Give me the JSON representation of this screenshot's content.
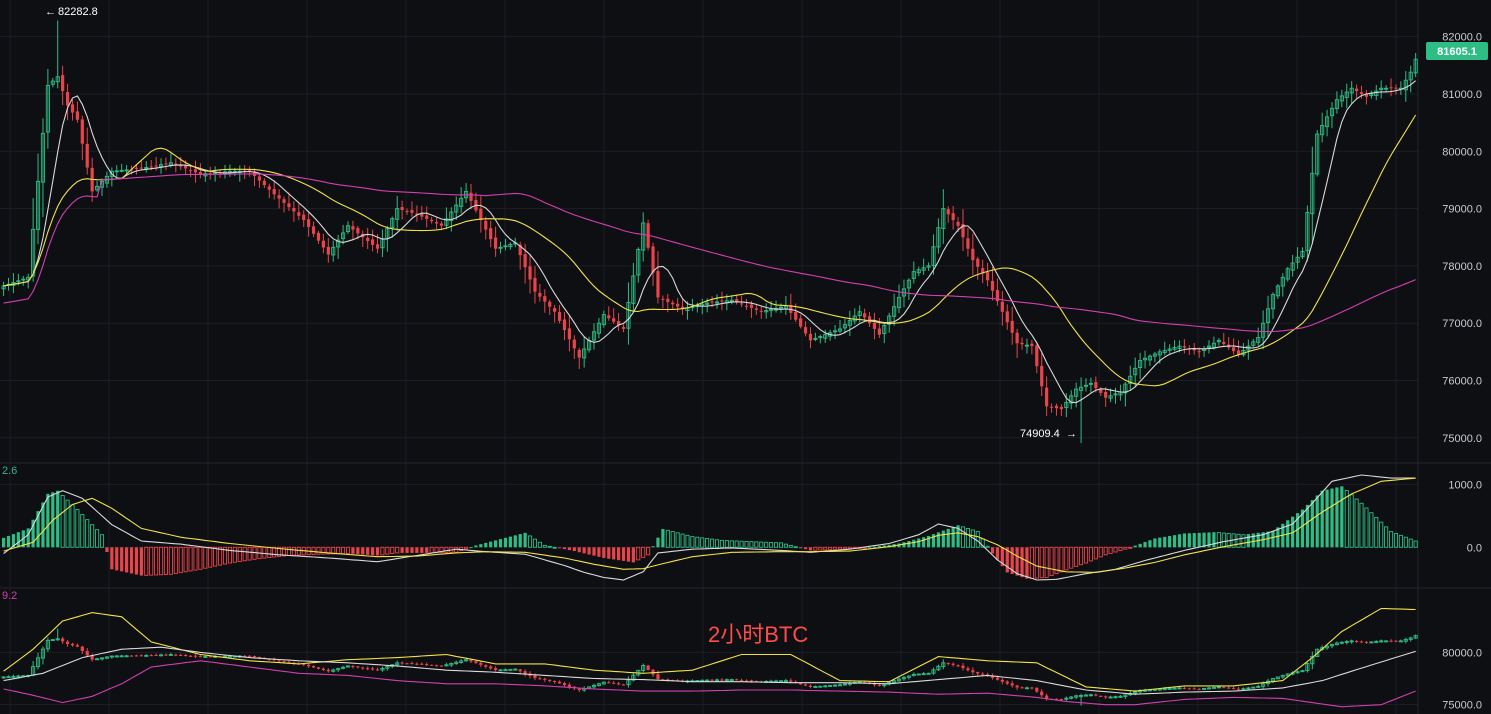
{
  "watermark": "2小时BTC",
  "colors": {
    "background": "#0e0f12",
    "up": "#2ebd85",
    "down": "#e9444a",
    "ma_fast": "#d9d9d9",
    "ma_mid": "#f0e24a",
    "ma_slow": "#d13fb1",
    "grid": "#1c1e24"
  },
  "chart_data": [
    {
      "type": "candlestick",
      "y_ticks": [
        "82000.0",
        "81000.0",
        "80000.0",
        "79000.0",
        "78000.0",
        "77000.0",
        "76000.0",
        "75000.0"
      ],
      "ylim": [
        74700,
        82500
      ],
      "high_label": "82282.8",
      "low_label": "74909.4",
      "last_price": "81605.1",
      "close_path": [
        [
          0,
          77650
        ],
        [
          5,
          77800
        ],
        [
          9,
          81150
        ],
        [
          11,
          81300
        ],
        [
          13,
          80800
        ],
        [
          15,
          80550
        ],
        [
          18,
          79300
        ],
        [
          22,
          79650
        ],
        [
          28,
          79700
        ],
        [
          34,
          79800
        ],
        [
          40,
          79600
        ],
        [
          46,
          79650
        ],
        [
          50,
          79650
        ],
        [
          55,
          79250
        ],
        [
          61,
          78800
        ],
        [
          66,
          78200
        ],
        [
          70,
          78700
        ],
        [
          76,
          78300
        ],
        [
          80,
          79000
        ],
        [
          84,
          78900
        ],
        [
          89,
          78700
        ],
        [
          94,
          79300
        ],
        [
          100,
          78300
        ],
        [
          104,
          78400
        ],
        [
          108,
          77550
        ],
        [
          112,
          77200
        ],
        [
          117,
          76400
        ],
        [
          122,
          77150
        ],
        [
          126,
          76900
        ],
        [
          130,
          78750
        ],
        [
          133,
          77450
        ],
        [
          138,
          77250
        ],
        [
          143,
          77350
        ],
        [
          148,
          77400
        ],
        [
          154,
          77200
        ],
        [
          159,
          77300
        ],
        [
          164,
          76700
        ],
        [
          170,
          76900
        ],
        [
          174,
          77200
        ],
        [
          178,
          76800
        ],
        [
          182,
          77450
        ],
        [
          185,
          77900
        ],
        [
          188,
          78000
        ],
        [
          191,
          79000
        ],
        [
          194,
          78700
        ],
        [
          197,
          78100
        ],
        [
          200,
          77750
        ],
        [
          203,
          77200
        ],
        [
          206,
          76650
        ],
        [
          209,
          76600
        ],
        [
          212,
          75550
        ],
        [
          215,
          75500
        ],
        [
          218,
          75850
        ],
        [
          221,
          75950
        ],
        [
          224,
          75700
        ],
        [
          227,
          75800
        ],
        [
          231,
          76350
        ],
        [
          235,
          76500
        ],
        [
          239,
          76600
        ],
        [
          243,
          76500
        ],
        [
          247,
          76700
        ],
        [
          251,
          76450
        ],
        [
          255,
          76750
        ],
        [
          258,
          77500
        ],
        [
          261,
          77950
        ],
        [
          264,
          78250
        ],
        [
          267,
          80300
        ],
        [
          271,
          80900
        ],
        [
          274,
          81100
        ],
        [
          277,
          80950
        ],
        [
          280,
          81100
        ],
        [
          284,
          81100
        ],
        [
          286,
          81380
        ],
        [
          287,
          81605.1
        ]
      ]
    },
    {
      "type": "bar",
      "panel": "macd",
      "y_ticks": [
        "1000.0",
        "0.0"
      ],
      "ylim": [
        -600,
        1150
      ],
      "corner_label": "2.6",
      "histogram_path": [
        [
          0,
          150
        ],
        [
          5,
          300
        ],
        [
          9,
          850
        ],
        [
          11,
          900
        ],
        [
          15,
          600
        ],
        [
          20,
          200
        ],
        [
          22,
          -350
        ],
        [
          28,
          -450
        ],
        [
          34,
          -430
        ],
        [
          40,
          -350
        ],
        [
          46,
          -250
        ],
        [
          52,
          -180
        ],
        [
          58,
          -130
        ],
        [
          64,
          -110
        ],
        [
          70,
          -100
        ],
        [
          76,
          -130
        ],
        [
          80,
          -90
        ],
        [
          86,
          -90
        ],
        [
          92,
          -80
        ],
        [
          96,
          30
        ],
        [
          102,
          150
        ],
        [
          106,
          230
        ],
        [
          110,
          30
        ],
        [
          116,
          -60
        ],
        [
          122,
          -170
        ],
        [
          128,
          -240
        ],
        [
          131,
          -120
        ],
        [
          134,
          290
        ],
        [
          140,
          170
        ],
        [
          146,
          110
        ],
        [
          152,
          90
        ],
        [
          158,
          70
        ],
        [
          164,
          -50
        ],
        [
          170,
          -30
        ],
        [
          176,
          0
        ],
        [
          182,
          60
        ],
        [
          188,
          180
        ],
        [
          194,
          350
        ],
        [
          198,
          250
        ],
        [
          201,
          -100
        ],
        [
          204,
          -400
        ],
        [
          208,
          -500
        ],
        [
          212,
          -480
        ],
        [
          216,
          -360
        ],
        [
          220,
          -250
        ],
        [
          224,
          -120
        ],
        [
          228,
          -30
        ],
        [
          234,
          140
        ],
        [
          240,
          220
        ],
        [
          246,
          240
        ],
        [
          252,
          200
        ],
        [
          258,
          260
        ],
        [
          264,
          600
        ],
        [
          268,
          900
        ],
        [
          272,
          970
        ],
        [
          276,
          700
        ],
        [
          282,
          250
        ],
        [
          287,
          100
        ]
      ],
      "dif_path": [
        [
          0,
          -100
        ],
        [
          5,
          200
        ],
        [
          9,
          800
        ],
        [
          12,
          900
        ],
        [
          16,
          780
        ],
        [
          22,
          360
        ],
        [
          28,
          100
        ],
        [
          36,
          50
        ],
        [
          46,
          -50
        ],
        [
          56,
          -120
        ],
        [
          66,
          -170
        ],
        [
          76,
          -230
        ],
        [
          84,
          -130
        ],
        [
          92,
          -30
        ],
        [
          98,
          -70
        ],
        [
          106,
          -110
        ],
        [
          114,
          -290
        ],
        [
          118,
          -400
        ],
        [
          122,
          -480
        ],
        [
          126,
          -520
        ],
        [
          130,
          -390
        ],
        [
          133,
          -90
        ],
        [
          140,
          -30
        ],
        [
          148,
          -10
        ],
        [
          158,
          -50
        ],
        [
          164,
          -80
        ],
        [
          172,
          -30
        ],
        [
          180,
          60
        ],
        [
          186,
          200
        ],
        [
          190,
          370
        ],
        [
          194,
          300
        ],
        [
          198,
          100
        ],
        [
          202,
          -200
        ],
        [
          206,
          -420
        ],
        [
          210,
          -520
        ],
        [
          214,
          -510
        ],
        [
          220,
          -420
        ],
        [
          226,
          -350
        ],
        [
          232,
          -210
        ],
        [
          240,
          -50
        ],
        [
          248,
          90
        ],
        [
          256,
          200
        ],
        [
          262,
          370
        ],
        [
          266,
          700
        ],
        [
          270,
          1050
        ],
        [
          276,
          1150
        ],
        [
          282,
          1100
        ],
        [
          287,
          1100
        ]
      ],
      "dea_path": [
        [
          0,
          -60
        ],
        [
          6,
          80
        ],
        [
          10,
          430
        ],
        [
          14,
          680
        ],
        [
          18,
          780
        ],
        [
          22,
          620
        ],
        [
          28,
          300
        ],
        [
          36,
          160
        ],
        [
          46,
          60
        ],
        [
          56,
          -20
        ],
        [
          66,
          -90
        ],
        [
          76,
          -150
        ],
        [
          84,
          -140
        ],
        [
          92,
          -90
        ],
        [
          98,
          -70
        ],
        [
          106,
          -80
        ],
        [
          114,
          -170
        ],
        [
          120,
          -270
        ],
        [
          126,
          -350
        ],
        [
          130,
          -340
        ],
        [
          134,
          -260
        ],
        [
          140,
          -150
        ],
        [
          148,
          -80
        ],
        [
          158,
          -70
        ],
        [
          164,
          -70
        ],
        [
          172,
          -60
        ],
        [
          180,
          10
        ],
        [
          186,
          90
        ],
        [
          190,
          190
        ],
        [
          194,
          230
        ],
        [
          198,
          170
        ],
        [
          202,
          40
        ],
        [
          206,
          -140
        ],
        [
          210,
          -300
        ],
        [
          216,
          -390
        ],
        [
          222,
          -400
        ],
        [
          228,
          -330
        ],
        [
          234,
          -240
        ],
        [
          240,
          -120
        ],
        [
          248,
          10
        ],
        [
          256,
          120
        ],
        [
          262,
          230
        ],
        [
          268,
          560
        ],
        [
          274,
          850
        ],
        [
          280,
          1050
        ],
        [
          287,
          1100
        ]
      ]
    },
    {
      "type": "candlestick",
      "panel": "boll",
      "y_ticks": [
        "80000.0",
        "75000.0"
      ],
      "ylim": [
        74300,
        85200
      ],
      "corner_label": "9.2",
      "upper_path": [
        [
          0,
          78200
        ],
        [
          6,
          80300
        ],
        [
          12,
          83000
        ],
        [
          18,
          83800
        ],
        [
          24,
          83400
        ],
        [
          30,
          81000
        ],
        [
          40,
          79800
        ],
        [
          50,
          79200
        ],
        [
          60,
          78900
        ],
        [
          70,
          79300
        ],
        [
          80,
          79500
        ],
        [
          90,
          79800
        ],
        [
          100,
          78900
        ],
        [
          110,
          78900
        ],
        [
          120,
          78300
        ],
        [
          130,
          78000
        ],
        [
          140,
          78300
        ],
        [
          150,
          79800
        ],
        [
          160,
          79800
        ],
        [
          170,
          77300
        ],
        [
          180,
          77200
        ],
        [
          190,
          79600
        ],
        [
          200,
          79200
        ],
        [
          210,
          79000
        ],
        [
          220,
          76700
        ],
        [
          230,
          76300
        ],
        [
          240,
          76800
        ],
        [
          250,
          76800
        ],
        [
          260,
          77300
        ],
        [
          266,
          79500
        ],
        [
          272,
          82000
        ],
        [
          280,
          84200
        ],
        [
          287,
          84100
        ]
      ],
      "middle_path": [
        [
          0,
          77300
        ],
        [
          8,
          78000
        ],
        [
          16,
          79500
        ],
        [
          24,
          80300
        ],
        [
          32,
          80500
        ],
        [
          40,
          80000
        ],
        [
          50,
          79500
        ],
        [
          60,
          79200
        ],
        [
          70,
          79000
        ],
        [
          80,
          78700
        ],
        [
          90,
          78300
        ],
        [
          100,
          78100
        ],
        [
          110,
          77800
        ],
        [
          120,
          77500
        ],
        [
          130,
          77400
        ],
        [
          140,
          77200
        ],
        [
          150,
          77200
        ],
        [
          160,
          77100
        ],
        [
          170,
          77100
        ],
        [
          180,
          77000
        ],
        [
          190,
          77400
        ],
        [
          200,
          77800
        ],
        [
          210,
          77300
        ],
        [
          220,
          76400
        ],
        [
          230,
          76000
        ],
        [
          240,
          76200
        ],
        [
          250,
          76300
        ],
        [
          260,
          76600
        ],
        [
          268,
          77300
        ],
        [
          276,
          78500
        ],
        [
          287,
          80100
        ]
      ],
      "lower_path": [
        [
          0,
          76500
        ],
        [
          6,
          75900
        ],
        [
          12,
          75200
        ],
        [
          18,
          75800
        ],
        [
          24,
          77000
        ],
        [
          30,
          78600
        ],
        [
          40,
          79200
        ],
        [
          50,
          78600
        ],
        [
          60,
          78000
        ],
        [
          70,
          77800
        ],
        [
          80,
          77300
        ],
        [
          90,
          77000
        ],
        [
          100,
          77000
        ],
        [
          110,
          76800
        ],
        [
          120,
          76500
        ],
        [
          130,
          76300
        ],
        [
          140,
          76300
        ],
        [
          150,
          76400
        ],
        [
          160,
          76400
        ],
        [
          170,
          76300
        ],
        [
          180,
          76200
        ],
        [
          190,
          76000
        ],
        [
          200,
          76100
        ],
        [
          210,
          75700
        ],
        [
          216,
          75300
        ],
        [
          224,
          75000
        ],
        [
          230,
          75000
        ],
        [
          240,
          75500
        ],
        [
          250,
          75700
        ],
        [
          260,
          75600
        ],
        [
          266,
          75200
        ],
        [
          272,
          74800
        ],
        [
          280,
          75000
        ],
        [
          287,
          76300
        ]
      ]
    }
  ]
}
